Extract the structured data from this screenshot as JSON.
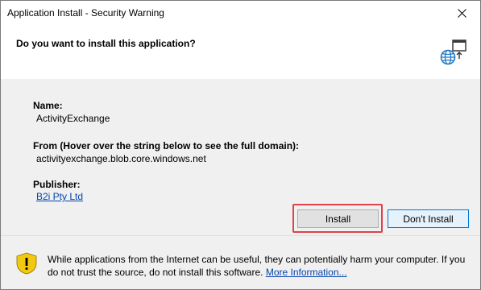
{
  "window": {
    "title": "Application Install - Security Warning"
  },
  "header": {
    "question": "Do you want to install this application?"
  },
  "details": {
    "name_label": "Name:",
    "name_value": "ActivityExchange",
    "from_label": "From (Hover over the string below to see the full domain):",
    "from_value": "activityexchange.blob.core.windows.net",
    "publisher_label": "Publisher:",
    "publisher_value": "B2i Pty Ltd"
  },
  "buttons": {
    "install_label": "Install",
    "dont_install_label": "Don't Install"
  },
  "footer": {
    "warning_text": "While applications from the Internet can be useful, they can potentially harm your computer. If you do not trust the source, do not install this software.",
    "more_info_link": "More Information..."
  },
  "colors": {
    "link": "#0645ad",
    "highlight": "#e0424a",
    "warning_shield": "#f2c811",
    "body_bg": "#f0f0f0"
  },
  "icons": {
    "close": "close-icon",
    "app": "globe-window-icon",
    "warning": "warning-shield-icon"
  }
}
